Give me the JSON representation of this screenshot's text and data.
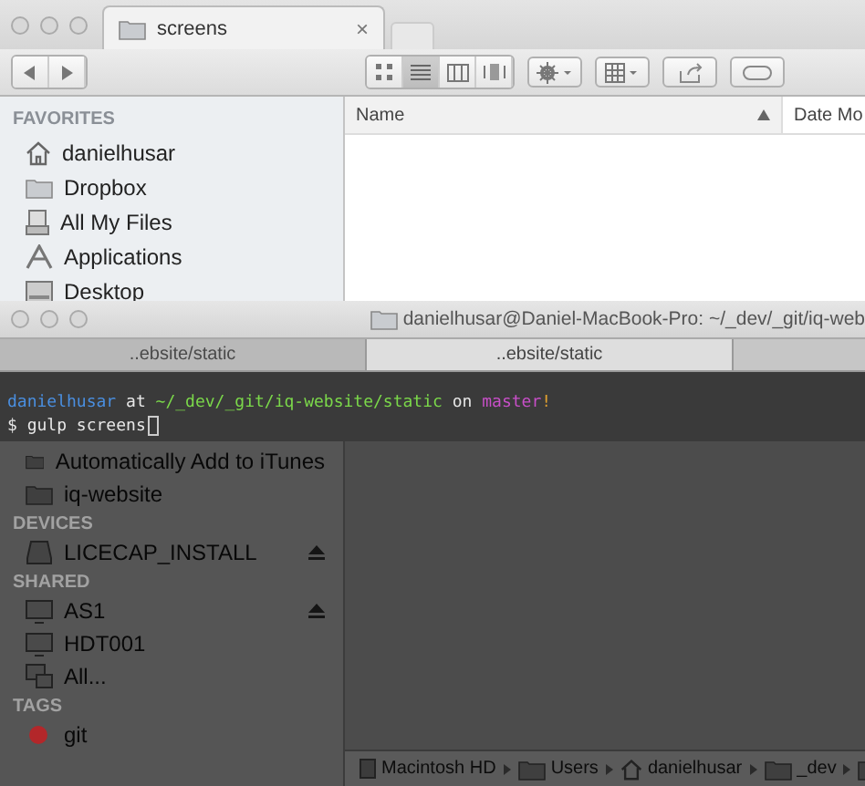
{
  "finder": {
    "tabs": [
      {
        "label": "screens",
        "selected": true,
        "close": "×"
      }
    ],
    "nav": [
      {
        "kind": "back"
      },
      {
        "kind": "forward"
      }
    ],
    "views": [
      {
        "kind": "icons",
        "selected": false
      },
      {
        "kind": "list",
        "selected": true
      },
      {
        "kind": "columns",
        "selected": false
      },
      {
        "kind": "coverflow",
        "selected": false
      }
    ],
    "tools": [
      {
        "kind": "action"
      },
      {
        "kind": "arrange"
      },
      {
        "kind": "share"
      },
      {
        "kind": "tags"
      }
    ],
    "sidebar": [
      {
        "heading": "FAVORITES",
        "items": [
          {
            "label": "danielhusar",
            "kind": "home",
            "eject": false
          },
          {
            "label": "Dropbox",
            "kind": "folder",
            "eject": false
          },
          {
            "label": "All My Files",
            "kind": "files",
            "eject": false
          },
          {
            "label": "Applications",
            "kind": "apps",
            "eject": false
          },
          {
            "label": "Desktop",
            "kind": "desktop",
            "eject": false
          },
          {
            "label": "Automatically Add to iTunes",
            "kind": "folder",
            "eject": false
          },
          {
            "label": "iq-website",
            "kind": "folder",
            "eject": false
          }
        ]
      },
      {
        "heading": "DEVICES",
        "items": [
          {
            "label": "LICECAP_INSTALL",
            "kind": "drive",
            "eject": true
          }
        ]
      },
      {
        "heading": "SHARED",
        "items": [
          {
            "label": "AS1",
            "kind": "screen",
            "eject": true
          },
          {
            "label": "HDT001",
            "kind": "screen",
            "eject": false
          },
          {
            "label": "All...",
            "kind": "network",
            "eject": false
          }
        ]
      },
      {
        "heading": "TAGS",
        "items": [
          {
            "label": "git",
            "kind": "tag",
            "color": "#b3272a",
            "eject": false
          }
        ]
      }
    ],
    "columns": [
      {
        "label": "Name",
        "sorted": true
      },
      {
        "label": "Date Mo",
        "sorted": false
      }
    ],
    "path": [
      {
        "label": "Macintosh HD",
        "kind": "disk"
      },
      {
        "label": "Users",
        "kind": "folder"
      },
      {
        "label": "danielhusar",
        "kind": "home"
      },
      {
        "label": "_dev",
        "kind": "folder"
      },
      {
        "kind": "folder"
      }
    ]
  },
  "terminal": {
    "title": "danielhusar@Daniel-MacBook-Pro: ~/_dev/_git/iq-web",
    "tabs": [
      {
        "label": "..ebsite/static",
        "selected": false
      },
      {
        "label": "..ebsite/static",
        "selected": true
      }
    ],
    "lines": [
      {
        "cursor": false,
        "segments": [
          {
            "text": "danielhusar",
            "color": "#4a8fe0"
          },
          {
            "text": " at ",
            "color": "#e8e8e8"
          },
          {
            "text": "~/_dev/_git/iq-website/static",
            "color": "#7bd84a"
          },
          {
            "text": " on ",
            "color": "#e8e8e8"
          },
          {
            "text": "master",
            "color": "#c84fc8"
          },
          {
            "text": "!",
            "color": "#e0a030"
          }
        ]
      },
      {
        "cursor": true,
        "segments": [
          {
            "text": "$ gulp screens",
            "color": "#e8e8e8"
          }
        ]
      }
    ]
  }
}
